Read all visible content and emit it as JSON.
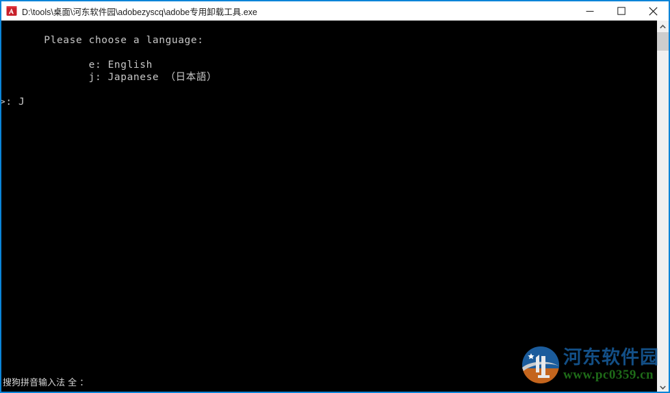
{
  "window": {
    "title": "D:\\tools\\桌面\\河东软件园\\adobezyscq\\adobe专用卸载工具.exe",
    "icon_name": "adobe-app-icon",
    "border_color": "#0a84d8",
    "titlebar_bg": "#ffffff",
    "titlebar_fg": "#1a1a1a"
  },
  "titlebar_buttons": {
    "minimize_label": "Minimize",
    "maximize_label": "Maximize",
    "close_label": "Close"
  },
  "terminal": {
    "background": "#000000",
    "foreground": "#c8c8c8",
    "lines": [
      "       Please choose a language:",
      "",
      "              e: English",
      "              j: Japanese （日本語）",
      "",
      ">: J"
    ],
    "content": "       Please choose a language:\n\n              e: English\n              j: Japanese （日本語）\n\n>: J",
    "prompt_symbol": ">:",
    "typed_input": "J",
    "options": [
      {
        "key": "e",
        "label": "English"
      },
      {
        "key": "j",
        "label": "Japanese （日本語）"
      }
    ],
    "question": "Please choose a language:"
  },
  "scrollbar": {
    "up_arrow_name": "scroll-up-arrow",
    "down_arrow_name": "scroll-down-arrow",
    "track_color": "#f0f0f0",
    "thumb_color": "#cdcdcd"
  },
  "ime": {
    "status_text": "搜狗拼音输入法 全 ："
  },
  "watermark": {
    "site_name": "河东软件园",
    "url": "www.pc0359.cn",
    "title_color": "#134f86",
    "url_color": "#1e6b18",
    "logo_blue": "#1b5c9c",
    "logo_orange": "#c4651d"
  }
}
